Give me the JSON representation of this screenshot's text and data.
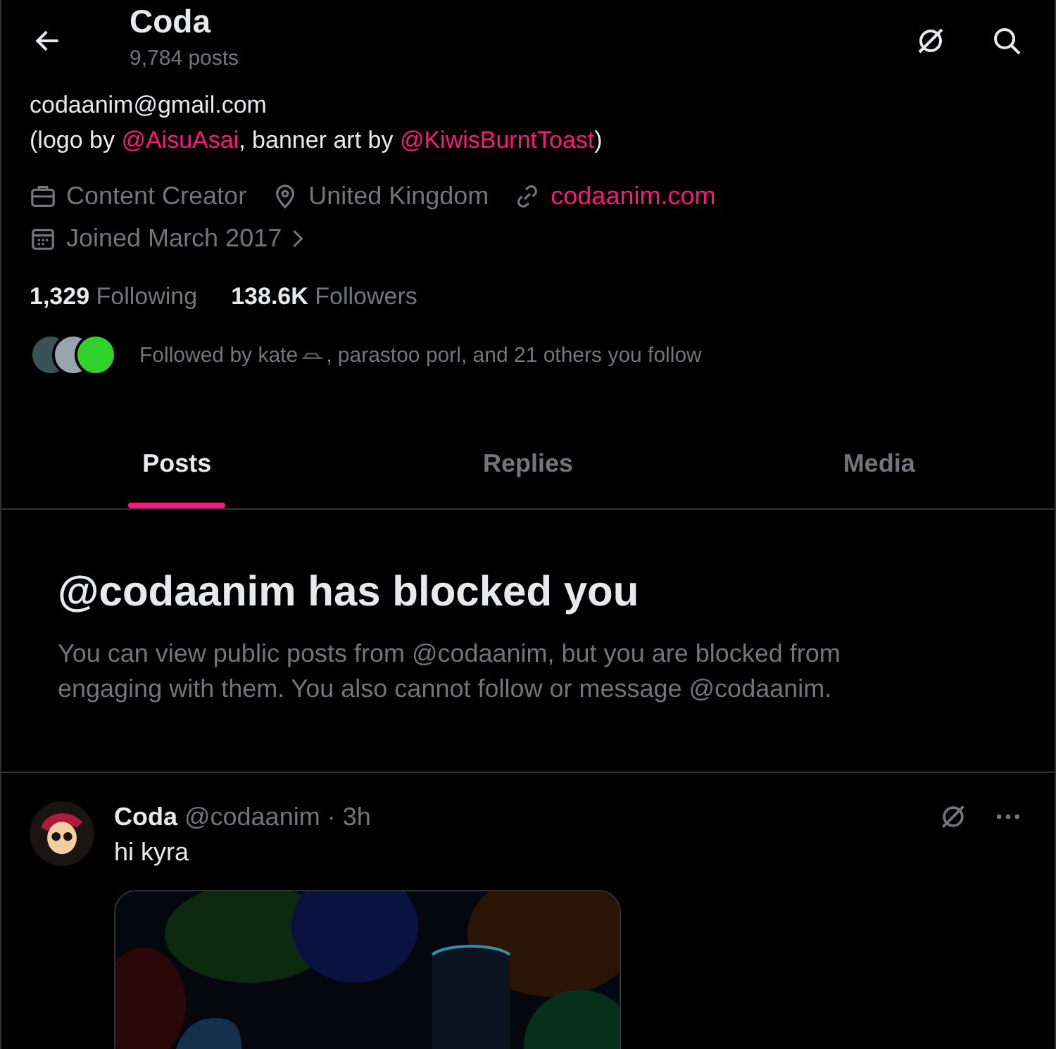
{
  "header": {
    "name": "Coda",
    "post_count": "9,784 posts"
  },
  "bio": {
    "lines": [
      "codaanim@gmail.com",
      "(logo by **@AisuAsai**, banner art by **@KiwisBurntToast**)"
    ]
  },
  "meta": [
    {
      "kind": "job",
      "text": "Content Creator"
    },
    {
      "kind": "location",
      "text": "United Kingdom"
    },
    {
      "kind": "link",
      "text": "codaanim.com"
    },
    {
      "kind": "joined",
      "text": "Joined March 2017"
    }
  ],
  "stats": [
    {
      "count": "1,329",
      "label": "Following"
    },
    {
      "count": "138.6K",
      "label": "Followers"
    }
  ],
  "followed_by": {
    "before": "Followed by kate",
    "after": ", parastoo porl, and 21 others you follow"
  },
  "tabs": [
    {
      "label": "Posts",
      "selected": true
    },
    {
      "label": "Replies",
      "selected": false
    },
    {
      "label": "Media",
      "selected": false
    }
  ],
  "blocked": {
    "title": "@codaanim has blocked you",
    "body": "You can view public posts from @codaanim, but you are blocked from engaging with them. You also cannot follow or message @codaanim."
  },
  "post": {
    "name": "Coda",
    "handle": "@codaanim",
    "time": "· 3h",
    "text": "hi kyra"
  }
}
